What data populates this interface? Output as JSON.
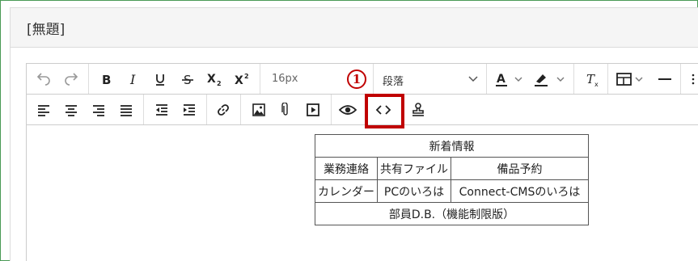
{
  "panel": {
    "title": "[無題]"
  },
  "toolbar": {
    "row1": {
      "undo_icon": "undo-icon",
      "redo_icon": "redo-icon",
      "bold_icon": "bold-icon",
      "italic_icon": "italic-icon",
      "underline_icon": "underline-icon",
      "strike_icon": "strikethrough-icon",
      "subscript_icon": "subscript-icon",
      "superscript_icon": "superscript-icon",
      "font_size": "16px",
      "block_format": "段落",
      "text_color_icon": "text-color-icon",
      "highlight_icon": "highlight-icon",
      "clear_format_icon": "clear-format-icon",
      "table_icon": "table-icon",
      "hr_icon": "horizontal-rule-icon"
    },
    "row2": {
      "align_left_icon": "align-left-icon",
      "align_center_icon": "align-center-icon",
      "align_right_icon": "align-right-icon",
      "align_justify_icon": "align-justify-icon",
      "outdent_icon": "outdent-icon",
      "indent_icon": "indent-icon",
      "link_icon": "link-icon",
      "image_icon": "image-icon",
      "attachment_icon": "attachment-icon",
      "media_icon": "media-icon",
      "preview_icon": "preview-icon",
      "code_icon": "code-icon",
      "stamp_icon": "stamp-icon"
    }
  },
  "annotation": {
    "number": "1",
    "color": "#c00000"
  },
  "content_table": {
    "header": "新着情報",
    "rows": [
      [
        "業務連絡",
        "共有ファイル",
        "備品予約"
      ],
      [
        "カレンダー",
        "PCのいろは",
        "Connect-CMSのいろは"
      ]
    ],
    "footer": "部員D.B.（機能制限版）"
  }
}
